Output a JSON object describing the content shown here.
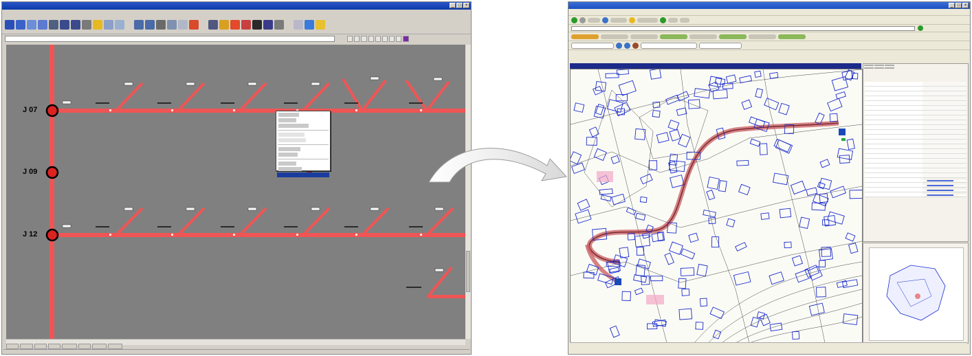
{
  "left_window": {
    "junctions": [
      {
        "label": "J 07"
      },
      {
        "label": "J 09"
      },
      {
        "label": "J 12"
      }
    ]
  },
  "colors": {
    "line": "#f05555",
    "node_fill": "#dd2222",
    "canvas": "#808080",
    "parcel_outline": "#1a2ccc",
    "route": "#c8585e"
  },
  "icons": [
    "minimize-icon",
    "maximize-icon",
    "close-icon",
    "cursor-icon",
    "curved-arrow-icon"
  ]
}
